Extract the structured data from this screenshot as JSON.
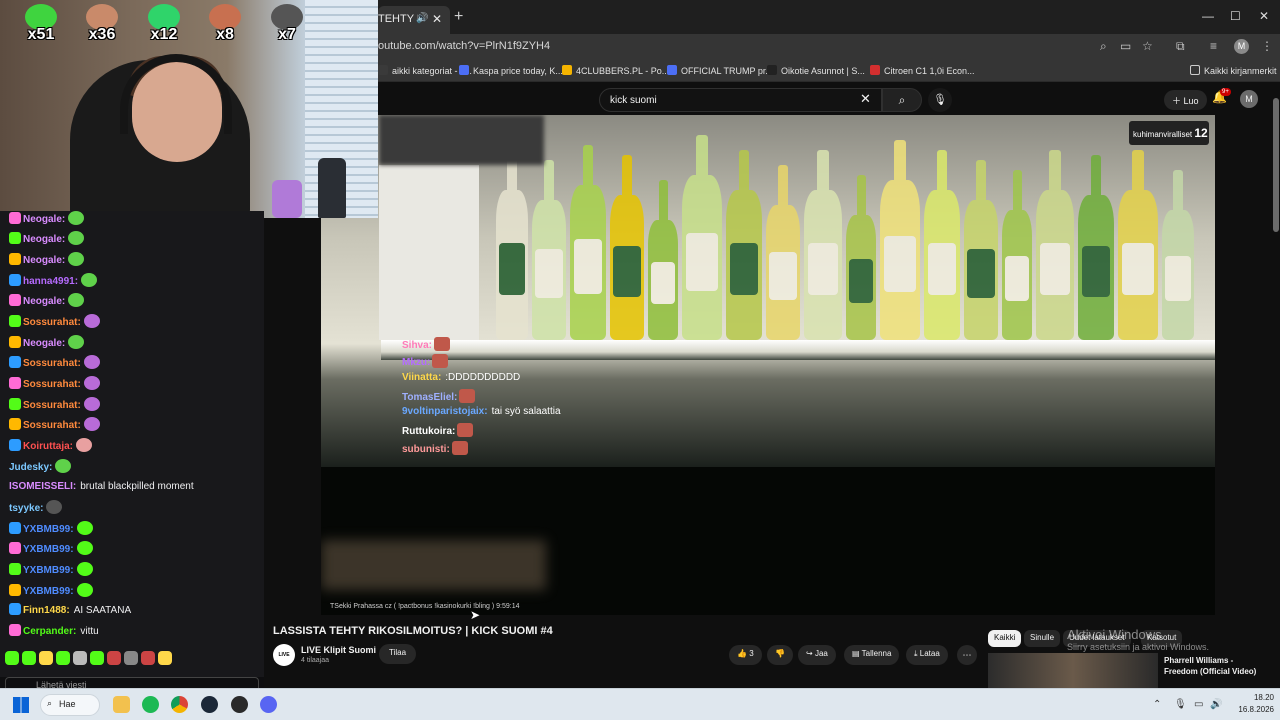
{
  "browser": {
    "tab_title": "TEHTY RIKO",
    "url": "outube.com/watch?v=PlrN1f9ZYH4",
    "bookmarks": [
      {
        "label": "aikki kategoriat - T...",
        "color": "#3a3a3a"
      },
      {
        "label": "Kaspa price today, K...",
        "color": "#4c6ef5"
      },
      {
        "label": "4CLUBBERS.PL - Po...",
        "color": "#f5b400"
      },
      {
        "label": "OFFICIAL TRUMP pr...",
        "color": "#4c6ef5"
      },
      {
        "label": "Oikotie Asunnot | S...",
        "color": "#222222"
      },
      {
        "label": "Citroen C1 1,0i Econ...",
        "color": "#d32f2f"
      }
    ],
    "all_bookmarks": "Kaikki kirjanmerkit",
    "profile_initial": "M"
  },
  "youtube": {
    "search_query": "kick suomi",
    "create_label": "Luo",
    "notif_count": "9+",
    "avatar_initial": "M",
    "video_title": "LASSISTA TEHTY RIKOSILMOITUS? | KICK SUOMI #4",
    "channel_name": "LIVE Klipit Suomi",
    "channel_subs": "4 tilaajaa",
    "channel_logo": "LIVE",
    "subscribe_label": "Tilaa",
    "like_count": "3",
    "share_label": "Jaa",
    "save_label": "Tallenna",
    "download_label": "Lataa",
    "chips": [
      "Kaikki",
      "Sinulle",
      "Uudet lataukset",
      "Katsotut"
    ],
    "rec_title": "Pharrell Williams - Freedom (Official Video)",
    "watermark": "kuhimanviralliset",
    "watermark_count": "12",
    "ticker": "TSekki Prahassa cz ( !pactbonus !kasinokurki !bling )  9:59:14",
    "overlay_chat": [
      {
        "user": "Sihva:",
        "text": "",
        "color": "#ff7ab8"
      },
      {
        "user": "Mkzu:",
        "text": "",
        "color": "#b46bff"
      },
      {
        "user": "Viinatta:",
        "text": ":DDDDDDDDDD",
        "color": "#ffd84a"
      },
      {
        "user": "TomasEliel:",
        "text": "",
        "color": "#9fb0ff"
      },
      {
        "user": "9voltinparistojaix:",
        "text": "tai syö salaattia",
        "color": "#6aa8ff"
      },
      {
        "user": "Ruttukoira:",
        "text": "",
        "color": "#ffffff"
      },
      {
        "user": "subunisti:",
        "text": "",
        "color": "#ff9a9a"
      }
    ]
  },
  "windows_activation": {
    "line1": "Aktivoi Windows",
    "line2": "Siirry asetuksiin ja aktivoi Windows."
  },
  "emote_counters": [
    "x51",
    "x36",
    "x12",
    "x8",
    "x7"
  ],
  "chat": {
    "messages": [
      {
        "user": "Neogale:",
        "text": "",
        "color": "#d98cff"
      },
      {
        "user": "Neogale:",
        "text": "",
        "color": "#d98cff"
      },
      {
        "user": "Neogale:",
        "text": "",
        "color": "#d98cff"
      },
      {
        "user": "hanna4991:",
        "text": "",
        "color": "#b66bff"
      },
      {
        "user": "Neogale:",
        "text": "",
        "color": "#d98cff"
      },
      {
        "user": "Sossurahat:",
        "text": "",
        "color": "#ff8a3d"
      },
      {
        "user": "Neogale:",
        "text": "",
        "color": "#d98cff"
      },
      {
        "user": "Sossurahat:",
        "text": "",
        "color": "#ff8a3d"
      },
      {
        "user": "Sossurahat:",
        "text": "",
        "color": "#ff8a3d"
      },
      {
        "user": "Sossurahat:",
        "text": "",
        "color": "#ff8a3d"
      },
      {
        "user": "Sossurahat:",
        "text": "",
        "color": "#ff8a3d"
      },
      {
        "user": "Koiruttaja:",
        "text": "",
        "color": "#ff5050"
      },
      {
        "user": "Judesky:",
        "text": "",
        "color": "#7cc8ff"
      },
      {
        "user": "ISOMEISSELI:",
        "text": "brutal blackpilled moment",
        "color": "#d98cff"
      },
      {
        "user": "tsyyke:",
        "text": "",
        "color": "#7cc8ff"
      },
      {
        "user": "YXBMB99:",
        "text": "",
        "color": "#4f8cff"
      },
      {
        "user": "YXBMB99:",
        "text": "",
        "color": "#4f8cff"
      },
      {
        "user": "YXBMB99:",
        "text": "",
        "color": "#4f8cff"
      },
      {
        "user": "YXBMB99:",
        "text": "",
        "color": "#4f8cff"
      },
      {
        "user": "Finn1488:",
        "text": "AI SAATANA",
        "color": "#ffd84a"
      },
      {
        "user": "Cerpander:",
        "text": "vittu",
        "color": "#53fc18"
      }
    ],
    "input_placeholder": "Lähetä viesti"
  },
  "taskbar": {
    "search_label": "Hae",
    "time": "18.20",
    "date": "16.8.2026"
  }
}
